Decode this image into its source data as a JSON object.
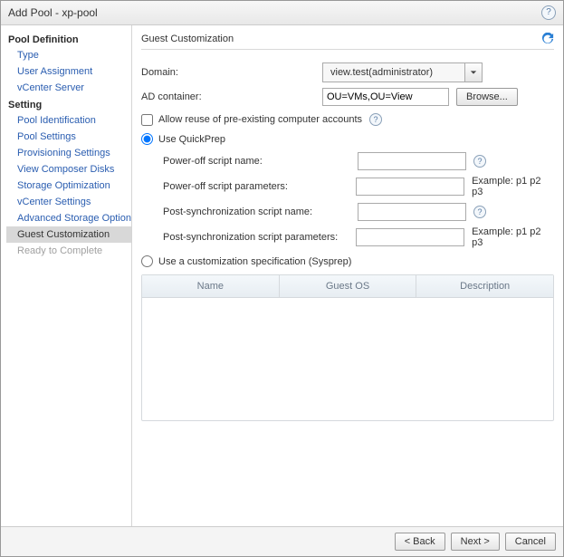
{
  "titlebar": {
    "title": "Add Pool - xp-pool"
  },
  "sidebar": {
    "groups": [
      {
        "heading": "Pool Definition",
        "items": [
          {
            "label": "Type"
          },
          {
            "label": "User Assignment"
          },
          {
            "label": "vCenter Server"
          }
        ]
      },
      {
        "heading": "Setting",
        "items": [
          {
            "label": "Pool Identification"
          },
          {
            "label": "Pool Settings"
          },
          {
            "label": "Provisioning Settings"
          },
          {
            "label": "View Composer Disks"
          },
          {
            "label": "Storage Optimization"
          },
          {
            "label": "vCenter Settings"
          },
          {
            "label": "Advanced Storage Options"
          },
          {
            "label": "Guest Customization",
            "selected": true
          },
          {
            "label": "Ready to Complete",
            "disabled": true
          }
        ]
      }
    ]
  },
  "section": {
    "title": "Guest Customization"
  },
  "form": {
    "domain_label": "Domain:",
    "domain_value": "view.test(administrator)",
    "adcontainer_label": "AD container:",
    "adcontainer_value": "OU=VMs,OU=View",
    "browse_btn": "Browse...",
    "allow_reuse": "Allow reuse of pre-existing computer accounts",
    "use_quickprep": "Use QuickPrep",
    "poweroff_name_label": "Power-off script name:",
    "poweroff_name_value": "",
    "poweroff_params_label": "Power-off script parameters:",
    "poweroff_params_value": "",
    "postsync_name_label": "Post-synchronization script name:",
    "postsync_name_value": "",
    "postsync_params_label": "Post-synchronization script parameters:",
    "postsync_params_value": "",
    "example_text": "Example: p1 p2 p3",
    "use_sysprep": "Use a customization specification (Sysprep)"
  },
  "table": {
    "columns": [
      "Name",
      "Guest OS",
      "Description"
    ]
  },
  "footer": {
    "back": "< Back",
    "next": "Next >",
    "cancel": "Cancel"
  }
}
